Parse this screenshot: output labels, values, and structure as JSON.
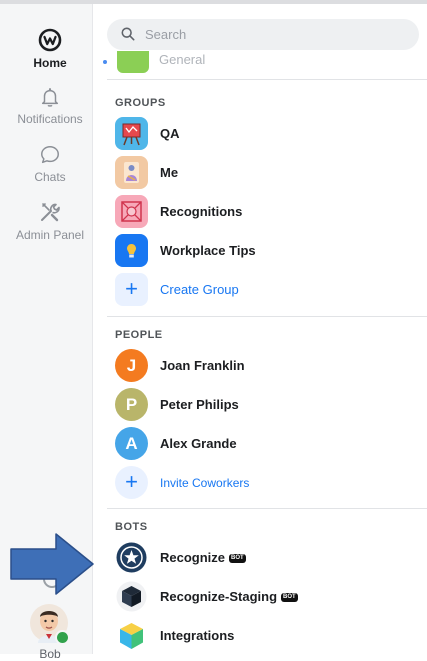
{
  "search": {
    "placeholder": "Search"
  },
  "sidebar": {
    "items": [
      {
        "label": "Home",
        "icon": "workplace-logo-icon"
      },
      {
        "label": "Notifications",
        "icon": "bell-icon"
      },
      {
        "label": "Chats",
        "icon": "chat-bubble-icon"
      },
      {
        "label": "Admin Panel",
        "icon": "tools-icon"
      }
    ],
    "profile": {
      "label": "Bob",
      "status": "online"
    }
  },
  "main": {
    "general_label": "General",
    "groups": {
      "title": "GROUPS",
      "items": [
        {
          "label": "QA",
          "color": "#4fb6e9"
        },
        {
          "label": "Me",
          "color": "#f2c9a3"
        },
        {
          "label": "Recognitions",
          "color": "#f7a8b8"
        },
        {
          "label": "Workplace Tips",
          "color": "#1877f2"
        }
      ],
      "create_label": "Create Group"
    },
    "people": {
      "title": "PEOPLE",
      "items": [
        {
          "initial": "J",
          "label": "Joan Franklin",
          "color": "#f47b20"
        },
        {
          "initial": "P",
          "label": "Peter Philips",
          "color": "#b9b56a"
        },
        {
          "initial": "A",
          "label": "Alex Grande",
          "color": "#45a5e8"
        }
      ],
      "invite_label": "Invite Coworkers"
    },
    "bots": {
      "title": "BOTS",
      "badge": "BOT",
      "items": [
        {
          "label": "Recognize",
          "bot": true
        },
        {
          "label": "Recognize-Staging",
          "bot": true
        },
        {
          "label": "Integrations",
          "bot": false
        }
      ]
    }
  },
  "colors": {
    "accent": "#1877f2",
    "arrow": "#3e6fb7",
    "arrow_border": "#2b4f8a"
  }
}
